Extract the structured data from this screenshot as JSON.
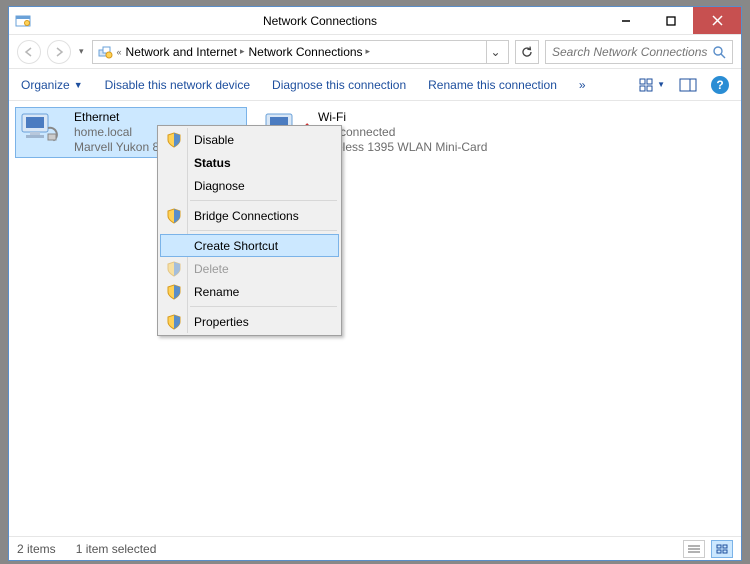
{
  "window": {
    "title": "Network Connections"
  },
  "addressbar": {
    "segments": [
      "Network and Internet",
      "Network Connections"
    ],
    "chevron": "«"
  },
  "search": {
    "placeholder": "Search Network Connections"
  },
  "toolbar": {
    "organize": "Organize",
    "disable": "Disable this network device",
    "diagnose": "Diagnose this connection",
    "rename": "Rename this connection",
    "overflow": "»"
  },
  "items": [
    {
      "name": "Ethernet",
      "line2": "home.local",
      "line3": "Marvell Yukon 8…",
      "selected": true
    },
    {
      "name": "Wi-Fi",
      "line2": "Not connected",
      "line3": "Wireless 1395 WLAN Mini-Card",
      "selected": false
    }
  ],
  "context_menu": {
    "disable": "Disable",
    "status": "Status",
    "diagnose": "Diagnose",
    "bridge": "Bridge Connections",
    "create_shortcut": "Create Shortcut",
    "delete": "Delete",
    "rename": "Rename",
    "properties": "Properties"
  },
  "statusbar": {
    "count": "2 items",
    "selected": "1 item selected"
  }
}
